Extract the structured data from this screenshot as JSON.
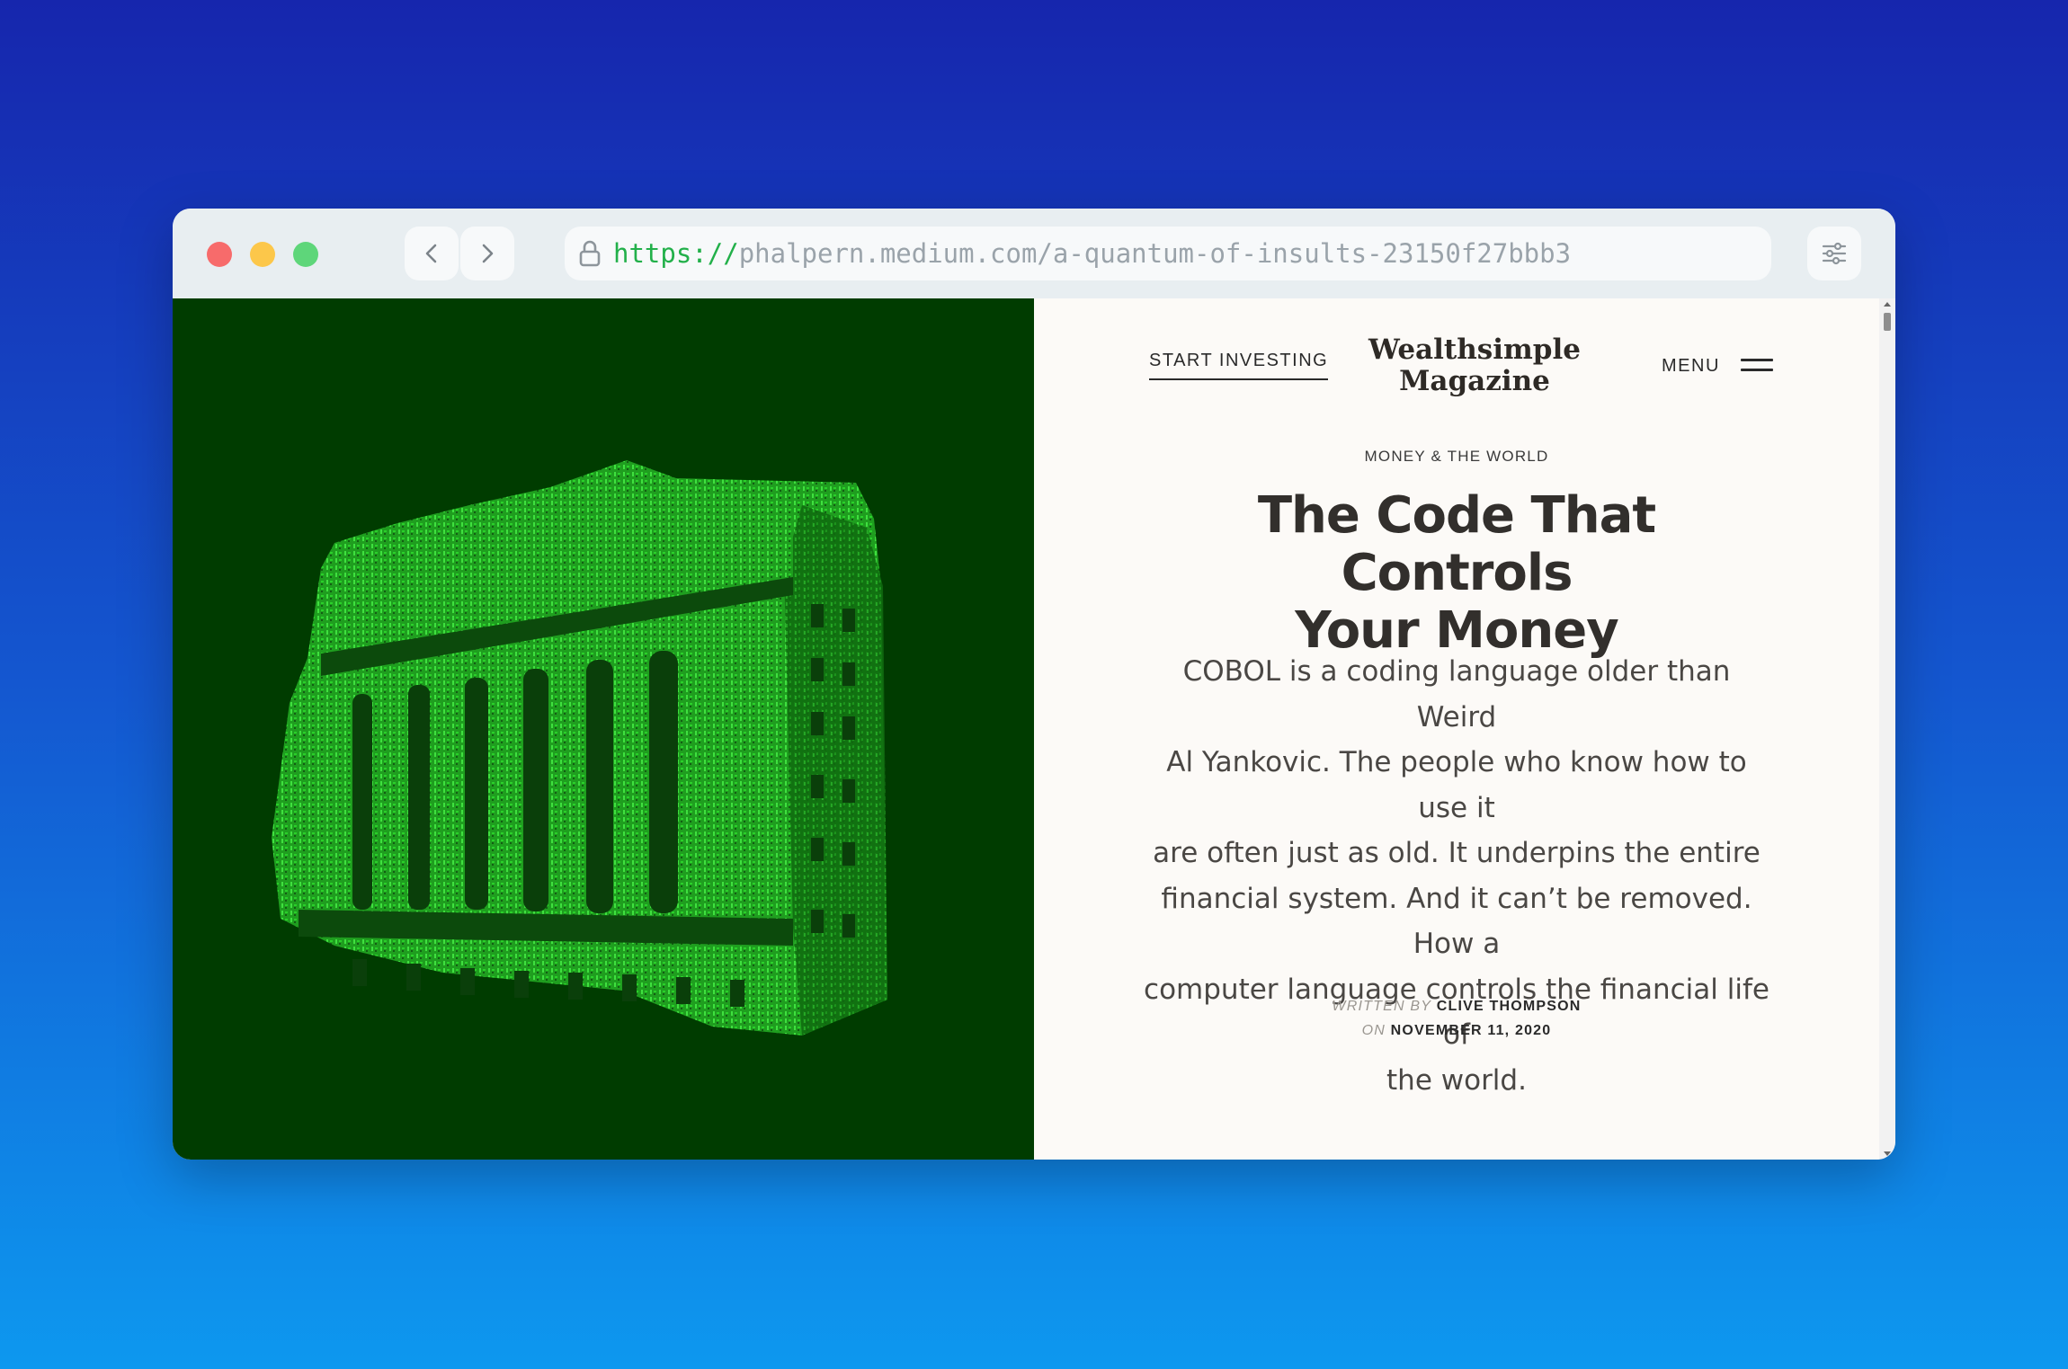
{
  "browser": {
    "url_scheme": "https://",
    "url_rest": "phalpern.medium.com/a-quantum-of-insults-23150f27bbb3"
  },
  "site": {
    "start_investing": "START INVESTING",
    "brand_line1": "Wealthsimple",
    "brand_line2": "Magazine",
    "menu_label": "MENU"
  },
  "article": {
    "category": "MONEY & THE WORLD",
    "headline_line1": "The Code That Controls",
    "headline_line2": "Your Money",
    "dek_lines": [
      "COBOL is a coding language older than Weird",
      "Al Yankovic. The people who know how to use it",
      "are often just as old. It underpins the entire",
      "financial system. And it can’t be removed. How a",
      "computer language controls the financial life of",
      "the world."
    ],
    "written_by_label": "WRITTEN BY",
    "author": "CLIVE THOMPSON",
    "on_label": "ON",
    "date": "NOVEMBER 11, 2020"
  },
  "hero": {
    "icon": "nyse-building-matrix-image",
    "colors": {
      "background": "#003c00",
      "glyph": "#22c022"
    }
  }
}
